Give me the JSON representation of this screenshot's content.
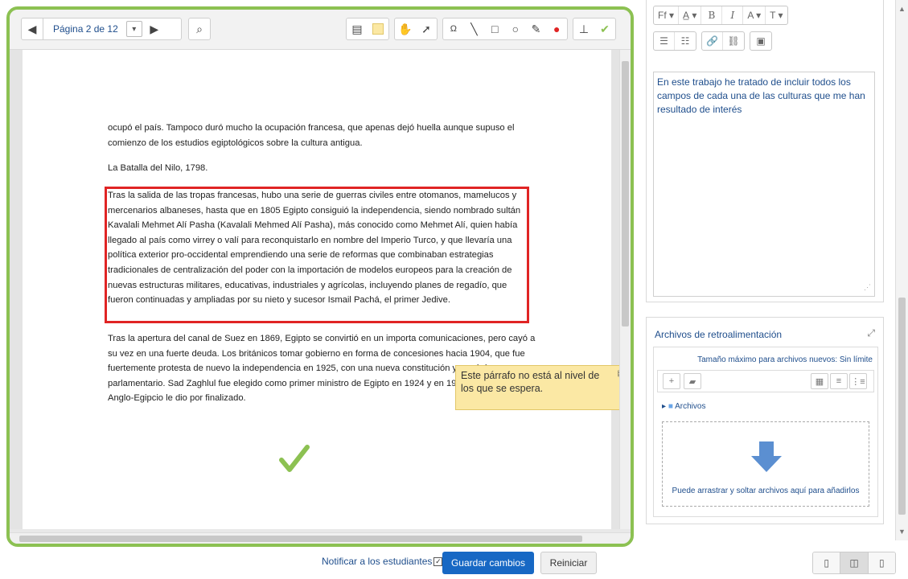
{
  "toolbar": {
    "page_label": "Página 2 de 12",
    "prev_icon": "triangle-left",
    "next_icon": "triangle-right",
    "search_icon": "search-page",
    "tools": [
      "comment",
      "color",
      "pan",
      "select",
      "stamp-text",
      "line",
      "rectangle",
      "oval",
      "pen",
      "highlight-color",
      "stamp",
      "check"
    ]
  },
  "document": {
    "p1": "ocupó el país. Tampoco duró mucho la ocupación francesa, que apenas dejó huella aunque supuso el comienzo de los estudios egiptológicos sobre la cultura antigua.",
    "p2": "La Batalla del Nilo, 1798.",
    "p3": "Tras la salida de las tropas francesas, hubo una serie de guerras civiles entre otomanos, mamelucos y mercenarios albaneses, hasta que en 1805 Egipto consiguió la independencia, siendo nombrado sultán Kavalali Mehmet Alí Pasha (Kavalali Mehmed Alí Pasha), más conocido como Mehmet Alí, quien había llegado al país como virrey o valí para reconquistarlo en nombre del Imperio Turco, y que llevaría una política exterior pro-occidental emprendiendo una serie de reformas que combinaban estrategias tradicionales de centralización del poder con la importación de modelos europeos para la creación de nuevas estructuras militares, educativas, industriales y agrícolas, incluyendo planes de regadío, que fueron continuadas y ampliadas por su nieto y sucesor Ismail Pachá, el primer Jedive.",
    "p4": "Tras la apertura del canal de Suez en 1869, Egipto se convirtió en un importa comunicaciones, pero cayó a su vez en una fuerte deuda. Los británicos tomar gobierno en forma de concesiones hacia 1904, que fue fuertemente protesta de nuevo la independencia en 1925, con una nueva constitución y un régimen parlamentario. Sad Zaghlul fue elegido como primer ministro de Egipto en 1924 y en 1936 el llamado tratado Anglo-Egipcio le dio por finalizado.",
    "comment": "Este párrafo no está al nivel de los que se espera.",
    "colors": {
      "frame": "#8cc152",
      "highlight": "#e02424",
      "comment_bg": "#fbe8a4",
      "check": "#8cc152"
    }
  },
  "editor": {
    "buttons_row1": [
      "Ff ▾",
      "A̲ ▾",
      "B",
      "I",
      "A ▾",
      "T ▾"
    ],
    "buttons_row2": [
      "☰",
      "☷",
      "🔗",
      "⛓",
      "▣"
    ],
    "text": "En este trabajo he tratado de incluir todos los campos de cada una de las culturas que me han resultado de interés"
  },
  "files": {
    "title": "Archivos de retroalimentación",
    "max_size": "Tamaño máximo para archivos nuevos: Sin límite",
    "folder": "Archivos",
    "drop_text": "Puede arrastrar y soltar archivos aquí para añadirlos"
  },
  "footer": {
    "notify_label": "Notificar a los estudiantes",
    "notify_checked": true,
    "save_label": "Guardar cambios",
    "reset_label": "Reiniciar",
    "accent": "#1768c4"
  }
}
